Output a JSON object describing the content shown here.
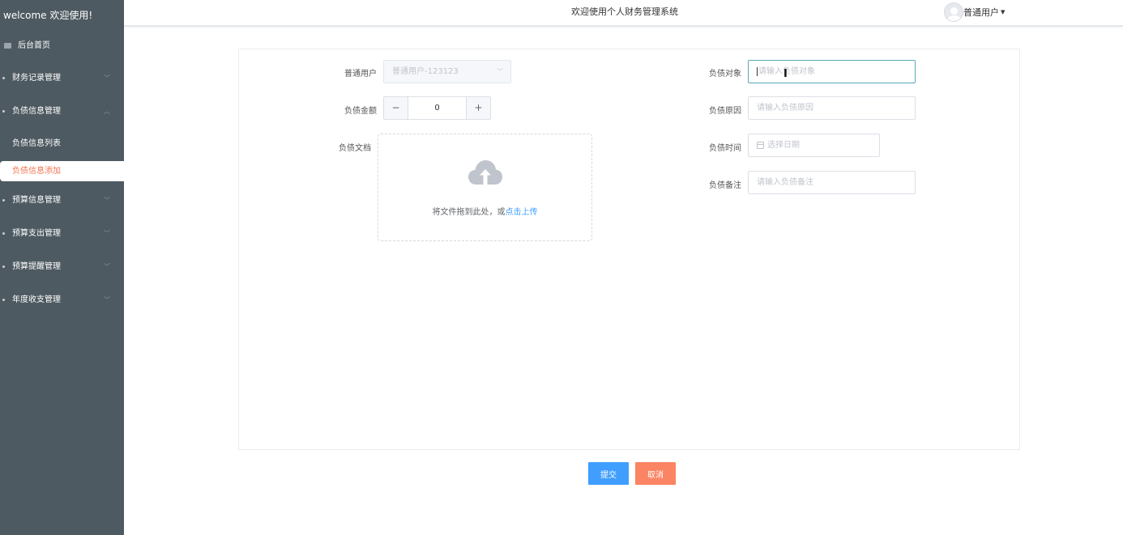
{
  "sidebar": {
    "brand": "welcome 欢迎使用!",
    "home": "后台首页",
    "menus": [
      {
        "label": "财务记录管理",
        "chev": "﹀"
      },
      {
        "label": "负债信息管理",
        "chev": "︿"
      },
      {
        "label": "预算信息管理",
        "chev": "﹀"
      },
      {
        "label": "预算支出管理",
        "chev": "﹀"
      },
      {
        "label": "预算提醒管理",
        "chev": "﹀"
      },
      {
        "label": "年度收支管理",
        "chev": "﹀"
      }
    ],
    "submenu": {
      "list": "负债信息列表",
      "add": "负债信息添加"
    }
  },
  "topbar": {
    "title": "欢迎使用个人财务管理系统",
    "user": "普通用户",
    "caret": "▼"
  },
  "form": {
    "user_label": "普通用户",
    "user_value": "普通用户-123123",
    "amount_label": "负债金额",
    "amount_value": "0",
    "minus": "−",
    "plus": "+",
    "doc_label": "负债文档",
    "upload_hint": "将文件拖到此处，或",
    "upload_link": "点击上传",
    "target_label": "负债对象",
    "target_placeholder": "请输入负债对象",
    "reason_label": "负债原因",
    "reason_placeholder": "请输入负债原因",
    "time_label": "负债时间",
    "time_placeholder": "选择日期",
    "note_label": "负债备注",
    "note_placeholder": "请输入负债备注"
  },
  "actions": {
    "submit": "提交",
    "cancel": "取消"
  },
  "colors": {
    "sidebar_bg": "#4e5a61",
    "active_text": "#f37350",
    "primary": "#409eff",
    "cancel": "#fa8464"
  }
}
